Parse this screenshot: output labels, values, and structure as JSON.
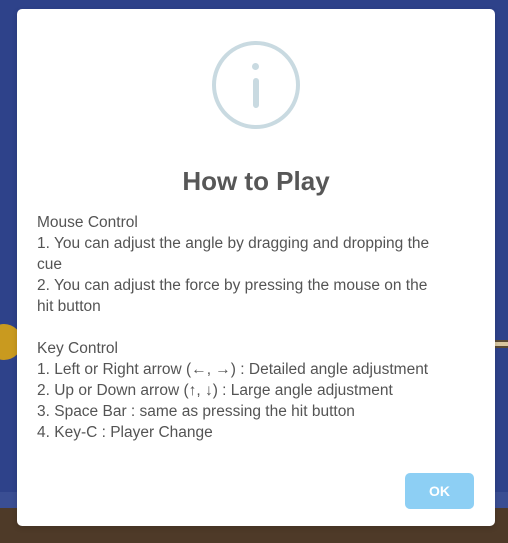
{
  "dialog": {
    "icon": "info-icon",
    "title": "How to Play",
    "sections": [
      {
        "heading": "Mouse Control",
        "lines": [
          "1. You can adjust the angle by dragging and dropping the",
          "cue",
          "2. You can adjust the force by pressing the mouse on the",
          "hit button"
        ]
      },
      {
        "heading": "Key Control",
        "lines": [
          "1. Left or Right arrow (←, →) : Detailed angle adjustment",
          "2. Up or Down arrow (↑, ↓) : Large angle adjustment",
          "3. Space Bar : same as pressing the hit button",
          "4. Key-C : Player Change"
        ]
      }
    ],
    "ok_label": "OK"
  },
  "colors": {
    "backdrop": "#2e428a",
    "icon": "#c9dae1",
    "title": "#575757",
    "body_text": "#545454",
    "ok_button": "#8dcff4"
  }
}
